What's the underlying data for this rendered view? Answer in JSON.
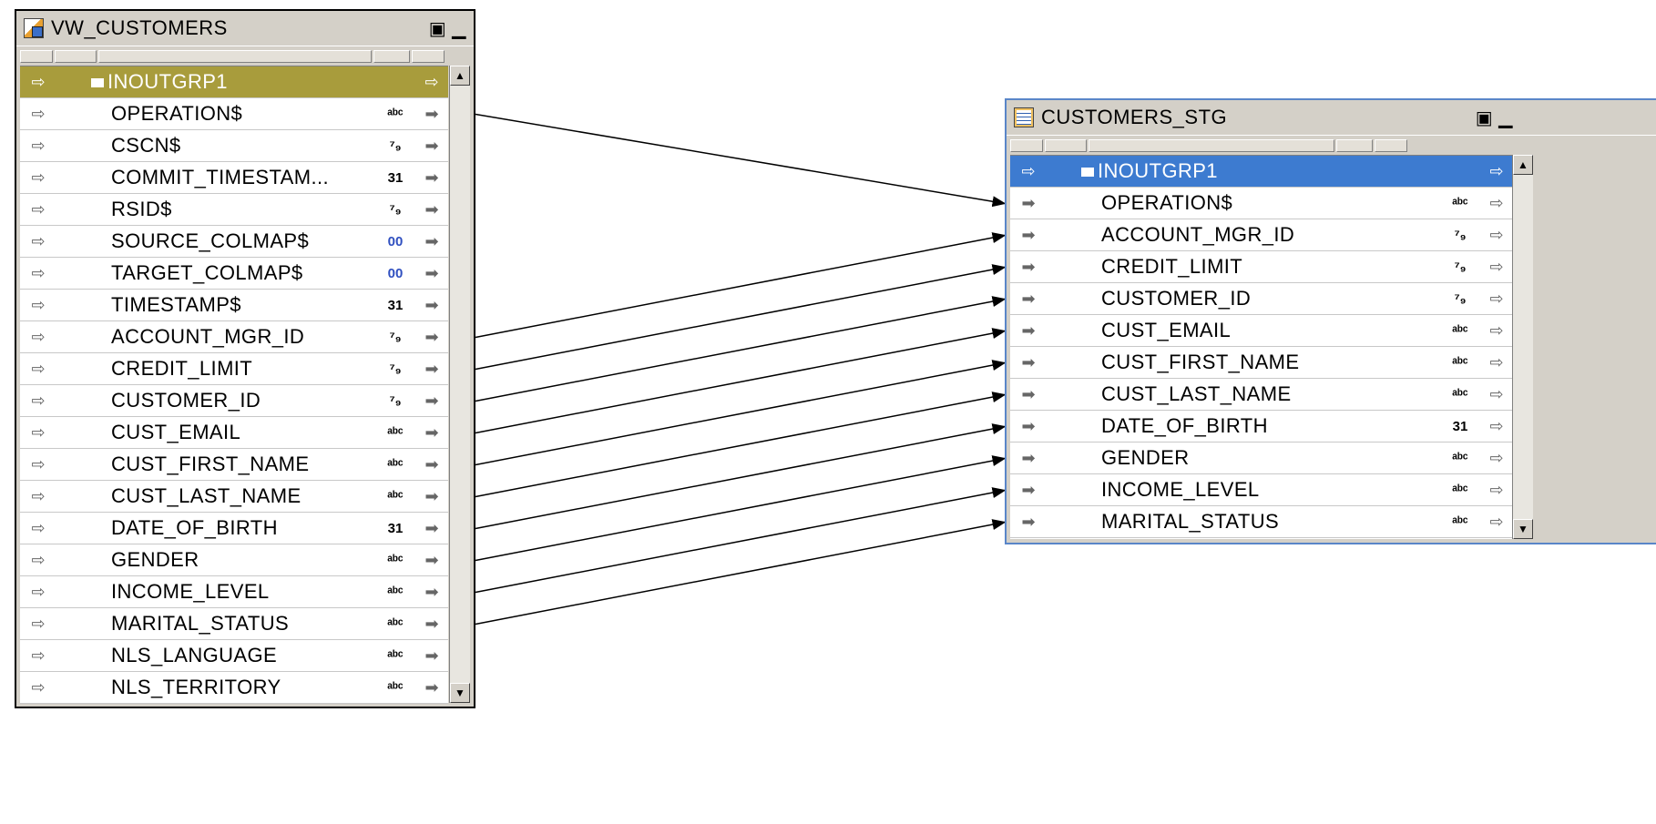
{
  "source": {
    "title": "VW_CUSTOMERS",
    "group": "INOUTGRP1",
    "rows": [
      {
        "name": "OPERATION$",
        "type": "ᵃᵇᶜ"
      },
      {
        "name": "CSCN$",
        "type": "⁷₉"
      },
      {
        "name": "COMMIT_TIMESTAM...",
        "type": "31"
      },
      {
        "name": "RSID$",
        "type": "⁷₉"
      },
      {
        "name": "SOURCE_COLMAP$",
        "type": "00"
      },
      {
        "name": "TARGET_COLMAP$",
        "type": "00"
      },
      {
        "name": "TIMESTAMP$",
        "type": "31"
      },
      {
        "name": "ACCOUNT_MGR_ID",
        "type": "⁷₉"
      },
      {
        "name": "CREDIT_LIMIT",
        "type": "⁷₉"
      },
      {
        "name": "CUSTOMER_ID",
        "type": "⁷₉"
      },
      {
        "name": "CUST_EMAIL",
        "type": "ᵃᵇᶜ"
      },
      {
        "name": "CUST_FIRST_NAME",
        "type": "ᵃᵇᶜ"
      },
      {
        "name": "CUST_LAST_NAME",
        "type": "ᵃᵇᶜ"
      },
      {
        "name": "DATE_OF_BIRTH",
        "type": "31"
      },
      {
        "name": "GENDER",
        "type": "ᵃᵇᶜ"
      },
      {
        "name": "INCOME_LEVEL",
        "type": "ᵃᵇᶜ"
      },
      {
        "name": "MARITAL_STATUS",
        "type": "ᵃᵇᶜ"
      },
      {
        "name": "NLS_LANGUAGE",
        "type": "ᵃᵇᶜ"
      },
      {
        "name": "NLS_TERRITORY",
        "type": "ᵃᵇᶜ"
      }
    ]
  },
  "target": {
    "title": "CUSTOMERS_STG",
    "group": "INOUTGRP1",
    "rows": [
      {
        "name": "OPERATION$",
        "type": "ᵃᵇᶜ"
      },
      {
        "name": "ACCOUNT_MGR_ID",
        "type": "⁷₉"
      },
      {
        "name": "CREDIT_LIMIT",
        "type": "⁷₉"
      },
      {
        "name": "CUSTOMER_ID",
        "type": "⁷₉"
      },
      {
        "name": "CUST_EMAIL",
        "type": "ᵃᵇᶜ"
      },
      {
        "name": "CUST_FIRST_NAME",
        "type": "ᵃᵇᶜ"
      },
      {
        "name": "CUST_LAST_NAME",
        "type": "ᵃᵇᶜ"
      },
      {
        "name": "DATE_OF_BIRTH",
        "type": "31"
      },
      {
        "name": "GENDER",
        "type": "ᵃᵇᶜ"
      },
      {
        "name": "INCOME_LEVEL",
        "type": "ᵃᵇᶜ"
      },
      {
        "name": "MARITAL_STATUS",
        "type": "ᵃᵇᶜ"
      }
    ]
  },
  "mappings": [
    {
      "from": "OPERATION$",
      "to": "OPERATION$"
    },
    {
      "from": "ACCOUNT_MGR_ID",
      "to": "ACCOUNT_MGR_ID"
    },
    {
      "from": "CREDIT_LIMIT",
      "to": "CREDIT_LIMIT"
    },
    {
      "from": "CUSTOMER_ID",
      "to": "CUSTOMER_ID"
    },
    {
      "from": "CUST_EMAIL",
      "to": "CUST_EMAIL"
    },
    {
      "from": "CUST_FIRST_NAME",
      "to": "CUST_FIRST_NAME"
    },
    {
      "from": "CUST_LAST_NAME",
      "to": "CUST_LAST_NAME"
    },
    {
      "from": "DATE_OF_BIRTH",
      "to": "DATE_OF_BIRTH"
    },
    {
      "from": "GENDER",
      "to": "GENDER"
    },
    {
      "from": "INCOME_LEVEL",
      "to": "INCOME_LEVEL"
    },
    {
      "from": "MARITAL_STATUS",
      "to": "MARITAL_STATUS"
    }
  ],
  "colors": {
    "source_group_bg": "#a89c3c",
    "target_group_bg": "#3d7bd0",
    "target_border": "#5a86c8",
    "type_date": "#000000",
    "type_raw": "#3050c0"
  }
}
